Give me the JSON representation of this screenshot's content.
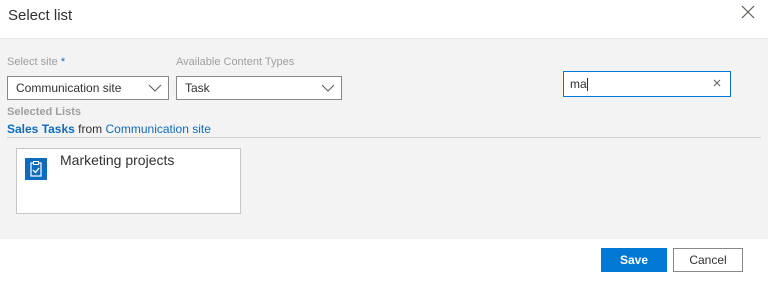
{
  "dialog": {
    "title": "Select list",
    "close_icon": "close-icon"
  },
  "form": {
    "site_label": "Select site",
    "site_required_marker": "*",
    "site_value": "Communication site",
    "content_types_label": "Available Content Types",
    "content_type_value": "Task",
    "search_value": "ma"
  },
  "selected": {
    "label": "Selected Lists",
    "list_name": "Sales Tasks",
    "from_text": "from",
    "site_name": "Communication site"
  },
  "results": [
    {
      "title": "Marketing projects",
      "icon": "task-list-icon"
    }
  ],
  "footer": {
    "save_label": "Save",
    "cancel_label": "Cancel"
  },
  "colors": {
    "accent": "#0078d4",
    "link": "#0f6cbd",
    "panel_bg": "#f3f3f3"
  }
}
